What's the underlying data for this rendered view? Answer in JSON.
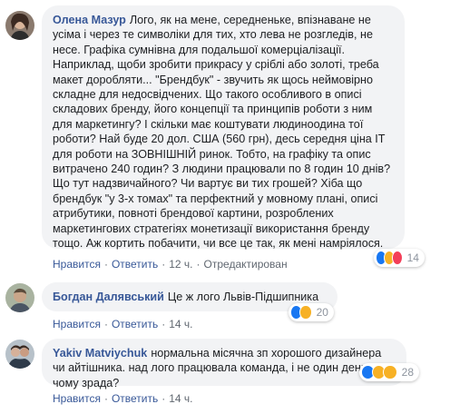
{
  "actions": {
    "like": "Нравится",
    "reply": "Ответить",
    "edited": "Отредактирован"
  },
  "comments": [
    {
      "author": "Олена Мазур",
      "text": "Лого, як на мене, середненьке, впізнаване не усіма і через те символіки для тих, хто лева не розгледів, не несе. Графіка сумнівна для подальшої комерціалізації. Наприклад, щоби зробити прикрасу у сріблі або золоті, треба макет доробляти... \"Брендбук\" - звучить як щось неймовірно складне для недосвідчених. Що такого особливого в описі складових бренду, його концепції та принципів роботи з ним для маркетингу? І скільки має коштувати людиноодина тої роботи? Най буде 20 дол. США (560 грн), десь середня ціна ІТ для роботи на ЗОВНІШНІЙ ринок. Тобто, на графіку та опис витрачено 240 годин? З людини працювали по 8 годин 10 днів? Що тут надзвичайного? Чи вартує ви тих грошей? Хіба що брендбук \"у 3-х томах\" та перфектний у мовному плані, описі атрибутики, повноті брендової картини, розроблених маркетингових стратегіях монетизації використання бренду тощо. Аж кортить побачити, чи все це так, як мені намріялося.",
      "time": "12 ч.",
      "edited": true,
      "reactions": [
        "like",
        "haha",
        "love"
      ],
      "count": "14"
    },
    {
      "author": "Богдан Далявський",
      "text": "Це ж лого Львів-Підшипника",
      "time": "14 ч.",
      "edited": false,
      "reactions": [
        "like",
        "haha"
      ],
      "count": "20"
    },
    {
      "author": "Yakiv Matviychuk",
      "text": "нормальна місячна зп хорошого дизайнера чи айтішника. над лого працювала команда, і не один день -в чому зрада?",
      "time": "14 ч.",
      "edited": false,
      "reactions": [
        "like",
        "haha",
        "wow"
      ],
      "count": "28"
    }
  ],
  "colors": {
    "author": "#385898",
    "bubble": "#f2f3f5",
    "like": "#1877f2",
    "haha": "#f7b125",
    "love": "#f33e58"
  }
}
